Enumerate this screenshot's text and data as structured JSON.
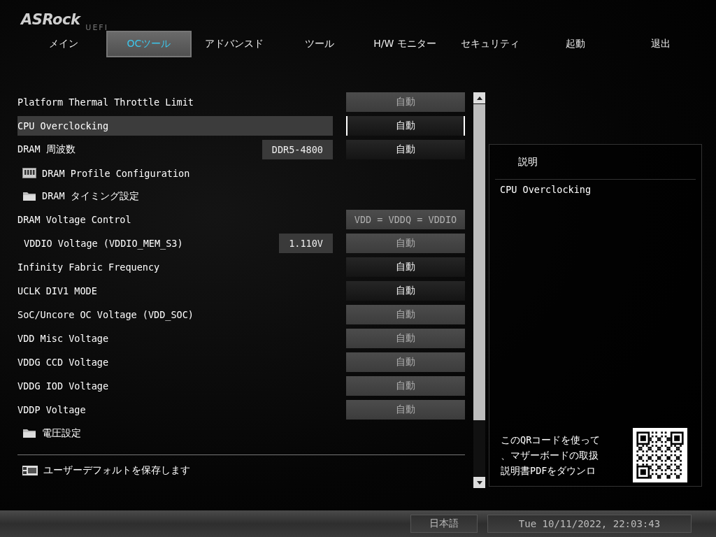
{
  "logo": {
    "brand": "ASRock",
    "suffix": "UEFI"
  },
  "tabs": [
    {
      "label": "メイン",
      "selected": false
    },
    {
      "label": "OCツール",
      "selected": true
    },
    {
      "label": "アドバンスド",
      "selected": false
    },
    {
      "label": "ツール",
      "selected": false
    },
    {
      "label": "H/W モニター",
      "selected": false
    },
    {
      "label": "セキュリティ",
      "selected": false
    },
    {
      "label": "起動",
      "selected": false
    },
    {
      "label": "退出",
      "selected": false
    }
  ],
  "settings": [
    {
      "kind": "setting",
      "label": "Platform Thermal Throttle Limit",
      "option": "自動",
      "disabled": true,
      "selected": false
    },
    {
      "kind": "setting",
      "label": "CPU Overclocking",
      "option": "自動",
      "disabled": false,
      "selected": true
    },
    {
      "kind": "setting",
      "label": "DRAM 周波数",
      "readout": "DDR5-4800",
      "option": "自動",
      "disabled": false,
      "selected": false
    },
    {
      "kind": "profile",
      "label": "DRAM Profile Configuration",
      "selected": false
    },
    {
      "kind": "folder",
      "label": "DRAM タイミング設定",
      "selected": false
    },
    {
      "kind": "setting",
      "label": "DRAM Voltage Control",
      "option": "VDD = VDDQ = VDDIO",
      "disabled": true,
      "selected": false,
      "children": [
        {
          "kind": "setting",
          "label": "VDDIO Voltage (VDDIO_MEM_S3)",
          "readout": "1.110V",
          "option": "自動",
          "disabled": true,
          "selected": false
        }
      ]
    },
    {
      "kind": "setting",
      "label": "Infinity Fabric Frequency",
      "option": "自動",
      "disabled": false,
      "selected": false
    },
    {
      "kind": "setting",
      "label": "UCLK DIV1 MODE",
      "option": "自動",
      "disabled": false,
      "selected": false
    },
    {
      "kind": "setting",
      "label": "SoC/Uncore OC Voltage (VDD_SOC)",
      "option": "自動",
      "disabled": true,
      "selected": false
    },
    {
      "kind": "setting",
      "label": "VDD Misc Voltage",
      "option": "自動",
      "disabled": true,
      "selected": false
    },
    {
      "kind": "setting",
      "label": "VDDG CCD Voltage",
      "option": "自動",
      "disabled": true,
      "selected": false
    },
    {
      "kind": "setting",
      "label": "VDDG IOD Voltage",
      "option": "自動",
      "disabled": true,
      "selected": false
    },
    {
      "kind": "setting",
      "label": "VDDP Voltage",
      "option": "自動",
      "disabled": true,
      "selected": false
    },
    {
      "kind": "folder",
      "label": "電圧設定",
      "selected": false
    }
  ],
  "save_action": {
    "label": "ユーザーデフォルトを保存します"
  },
  "description": {
    "title": "説明",
    "text": "CPU Overclocking",
    "qr_text": [
      "このQRコードを使って",
      "、マザーボードの取扱",
      "説明書PDFをダウンロ"
    ]
  },
  "status_bar": {
    "language": "日本語",
    "datetime": "Tue 10/11/2022, 22:03:43"
  }
}
